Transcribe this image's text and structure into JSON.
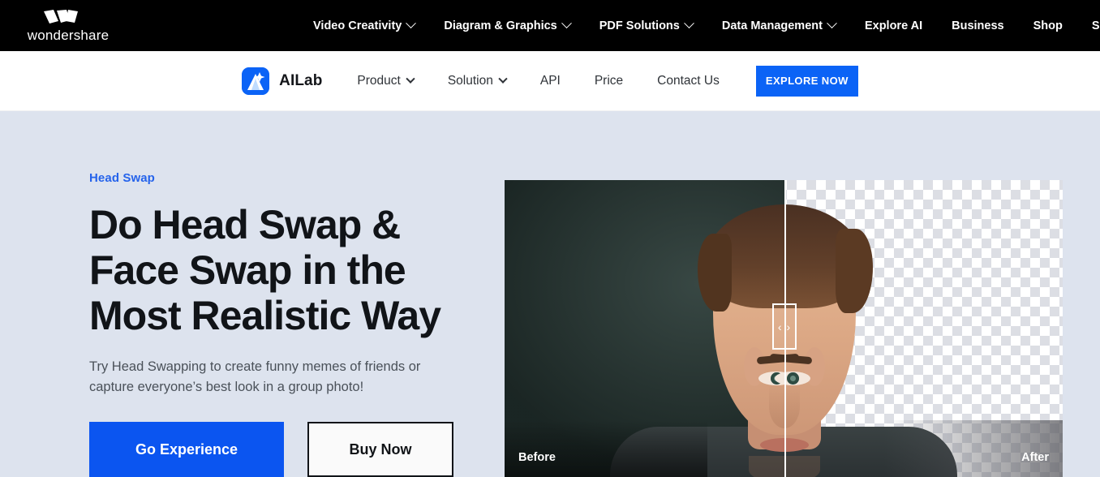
{
  "topnav": {
    "logo": {
      "wordmark": "wondershare",
      "mark_icon": "wondershare-w-icon"
    },
    "items": [
      {
        "label": "Video Creativity",
        "has_caret": true
      },
      {
        "label": "Diagram & Graphics",
        "has_caret": true
      },
      {
        "label": "PDF Solutions",
        "has_caret": true
      },
      {
        "label": "Data Management",
        "has_caret": true
      },
      {
        "label": "Explore AI",
        "has_caret": false
      },
      {
        "label": "Business",
        "has_caret": false
      },
      {
        "label": "Shop",
        "has_caret": false
      },
      {
        "label": "Support",
        "has_caret": false
      }
    ]
  },
  "subnav": {
    "brand_name": "AILab",
    "brand_icon": "ailab-logo-icon",
    "items": [
      {
        "label": "Product",
        "has_caret": true
      },
      {
        "label": "Solution",
        "has_caret": true
      },
      {
        "label": "API",
        "has_caret": false
      },
      {
        "label": "Price",
        "has_caret": false
      },
      {
        "label": "Contact Us",
        "has_caret": false
      }
    ],
    "cta_label": "EXPLORE NOW"
  },
  "hero": {
    "eyebrow": "Head Swap",
    "title_line1": "Do Head Swap &",
    "title_line2": "Face Swap in the",
    "title_line3": "Most Realistic Way",
    "subtitle_line1": "Try Head Swapping to create funny memes of friends or",
    "subtitle_line2": "capture everyone’s best look in a group photo!",
    "primary_cta": "Go Experience",
    "secondary_cta": "Buy Now"
  },
  "comparison": {
    "before_label": "Before",
    "after_label": "After",
    "handle_glyph": "‹ ›"
  },
  "colors": {
    "topnav_bg": "#000000",
    "hero_bg": "#dde3ee",
    "accent_blue": "#0b55f0",
    "eyebrow_blue": "#2563eb",
    "cta_blue": "#0b63f6",
    "text_dark": "#111418",
    "text_muted": "#4a5159",
    "before_bg": "#222e2c"
  }
}
